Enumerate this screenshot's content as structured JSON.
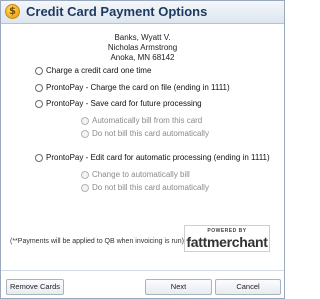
{
  "window": {
    "title": "Credit Card Payment Options",
    "icon": "dollar-coin-icon"
  },
  "customer": {
    "line1": "Banks, Wyatt V.",
    "line2": "Nicholas Armstrong",
    "line3": "Anoka, MN  68142"
  },
  "options": {
    "charge_once": "Charge a credit card one time",
    "charge_on_file": "ProntoPay - Charge the card on file (ending in 1111)",
    "save_card": "ProntoPay - Save card for future processing",
    "save_auto_bill": "Automatically bill from this card",
    "save_no_bill": "Do not bill this card automatically",
    "edit_card": "ProntoPay - Edit card for automatic processing (ending in 1111)",
    "edit_auto_bill": "Change to automatically bill",
    "edit_no_bill": "Do not bill this card automatically"
  },
  "note": "(**Payments will be applied to QB when invoicing is run)",
  "logo": {
    "powered_by": "POWERED BY",
    "brand": "fattmerchant"
  },
  "buttons": {
    "remove_cards": "Remove Cards",
    "next": "Next",
    "cancel": "Cancel"
  }
}
